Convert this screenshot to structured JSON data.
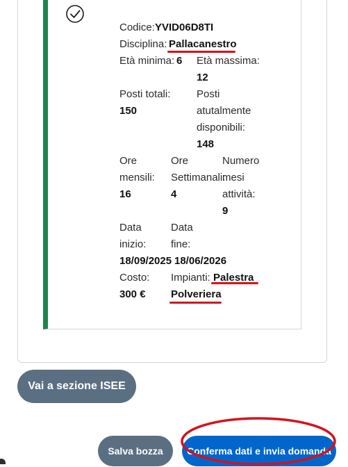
{
  "course": {
    "codice_label": "Codice:",
    "codice_value": "YVID06D8TI",
    "disciplina_label": "Disciplina:",
    "disciplina_value": "Pallacanestro",
    "eta_minima_label": "Età minima:",
    "eta_minima_value": "6",
    "eta_massima_label": "Età massima:",
    "eta_massima_value": "12",
    "posti_totali_label": "Posti totali:",
    "posti_totali_value": "150",
    "posti_disponibili_label_1": "Posti",
    "posti_disponibili_label_2": "atutalmente",
    "posti_disponibili_label_3": "disponibili:",
    "posti_disponibili_value": "148",
    "ore_mensili_label_1": "Ore",
    "ore_mensili_label_2": "mensili:",
    "ore_mensili_value": "16",
    "ore_settimanali_label_1": "Ore",
    "ore_settimanali_label_2": "Settimanali:",
    "ore_settimanali_value": "4",
    "numero_mesi_label_1": "Numero",
    "numero_mesi_label_2": "mesi",
    "numero_mesi_label_3": "attività:",
    "numero_mesi_value": "9",
    "data_inizio_label_1": "Data",
    "data_inizio_label_2": "inizio:",
    "data_inizio_value": "18/09/2025",
    "data_fine_label_1": "Data",
    "data_fine_label_2": "fine:",
    "data_fine_value": "18/06/2026",
    "costo_label": "Costo:",
    "costo_value": "300 €",
    "impianti_label": "Impianti:",
    "impianti_value_1": "Palestra",
    "impianti_value_2": "Polveriera"
  },
  "buttons": {
    "isee": "Vai a sezione ISEE",
    "draft": "Salva bozza",
    "submit": "Conferma dati e invia domanda"
  },
  "colors": {
    "accent_green": "#1e8449",
    "annotation_red": "#d5121b",
    "primary_blue": "#0066cc",
    "secondary_gray": "#5b6f82"
  },
  "icons": {
    "selected": "check-circle-icon"
  }
}
